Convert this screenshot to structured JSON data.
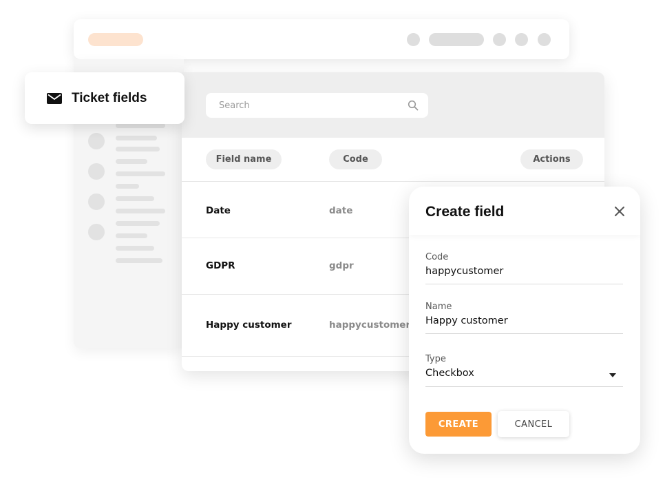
{
  "ticket_card": {
    "title": "Ticket fields",
    "icon": "envelope-icon"
  },
  "search": {
    "placeholder": "Search",
    "icon": "search-icon"
  },
  "table": {
    "columns": [
      "Field name",
      "Code",
      "Actions"
    ],
    "rows": [
      {
        "name": "Date",
        "code": "date"
      },
      {
        "name": "GDPR",
        "code": "gdpr"
      },
      {
        "name": "Happy customer",
        "code": "happycustomer"
      }
    ]
  },
  "dialog": {
    "title": "Create field",
    "fields": {
      "code": {
        "label": "Code",
        "value": "happycustomer"
      },
      "name": {
        "label": "Name",
        "value": "Happy customer"
      },
      "type": {
        "label": "Type",
        "value": "Checkbox"
      }
    },
    "create_label": "CREATE",
    "cancel_label": "CANCEL"
  },
  "colors": {
    "accent": "#fc9a36",
    "accent_light": "#fde3cf",
    "panel_header": "#eeeeee"
  }
}
